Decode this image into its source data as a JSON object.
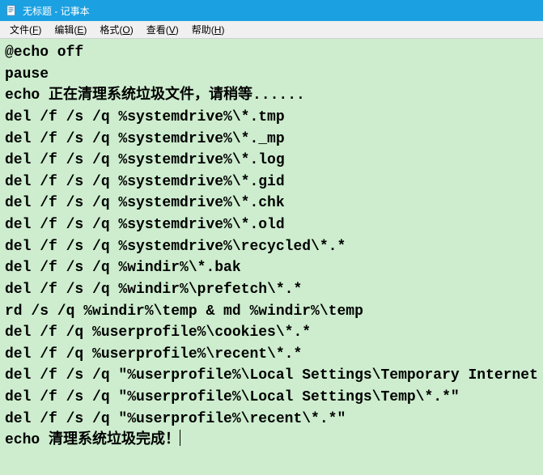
{
  "titlebar": {
    "title": "无标题 - 记事本"
  },
  "menubar": {
    "items": [
      {
        "label": "文件",
        "accel": "F"
      },
      {
        "label": "编辑",
        "accel": "E"
      },
      {
        "label": "格式",
        "accel": "O"
      },
      {
        "label": "查看",
        "accel": "V"
      },
      {
        "label": "帮助",
        "accel": "H"
      }
    ]
  },
  "content": {
    "lines": [
      "@echo off",
      "pause",
      "echo 正在清理系统垃圾文件，请稍等......",
      "del /f /s /q %systemdrive%\\*.tmp",
      "del /f /s /q %systemdrive%\\*._mp",
      "del /f /s /q %systemdrive%\\*.log",
      "del /f /s /q %systemdrive%\\*.gid",
      "del /f /s /q %systemdrive%\\*.chk",
      "del /f /s /q %systemdrive%\\*.old",
      "del /f /s /q %systemdrive%\\recycled\\*.*",
      "del /f /s /q %windir%\\*.bak",
      "del /f /s /q %windir%\\prefetch\\*.*",
      "rd /s /q %windir%\\temp & md %windir%\\temp",
      "del /f /q %userprofile%\\cookies\\*.*",
      "del /f /q %userprofile%\\recent\\*.*",
      "del /f /s /q \"%userprofile%\\Local Settings\\Temporary Internet",
      "del /f /s /q \"%userprofile%\\Local Settings\\Temp\\*.*\"",
      "del /f /s /q \"%userprofile%\\recent\\*.*\"",
      "echo 清理系统垃圾完成！"
    ]
  }
}
